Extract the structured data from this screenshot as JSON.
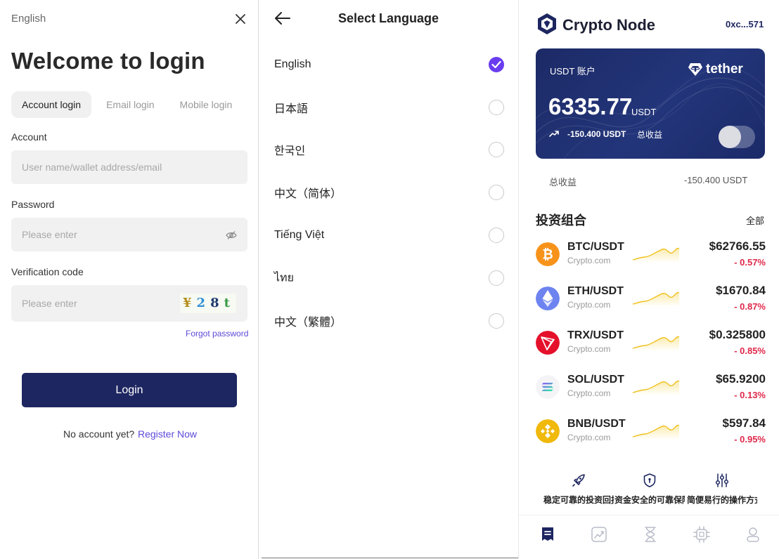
{
  "login": {
    "language": "English",
    "title": "Welcome to login",
    "tabs": [
      "Account login",
      "Email login",
      "Mobile login"
    ],
    "account_label": "Account",
    "account_placeholder": "User name/wallet address/email",
    "password_label": "Password",
    "password_placeholder": "Please enter",
    "code_label": "Verification code",
    "code_placeholder": "Please enter",
    "captcha_chars": [
      "¥",
      "2",
      "8",
      "t"
    ],
    "forgot": "Forgot password",
    "login_button": "Login",
    "no_account": "No account yet?",
    "register": "Register Now"
  },
  "language_picker": {
    "title": "Select Language",
    "selected": "English",
    "options": [
      "English",
      "日本語",
      "한국인",
      "中文（简体）",
      "Tiếng Việt",
      "ไทย",
      "中文（繁體）"
    ]
  },
  "crypto": {
    "app_name": "Crypto Node",
    "address": "0xc...571",
    "card": {
      "title": "USDT 账户",
      "brand": "tether",
      "amount": "6335.77",
      "unit": "USDT",
      "change": "-150.400 USDT",
      "change_label": "总收益",
      "toggle_on": false
    },
    "summary_label": "总收益",
    "summary_value": "-150.400 USDT",
    "portfolio_title": "投资组合",
    "portfolio_all": "全部",
    "coins": [
      {
        "pair": "BTC/USDT",
        "source": "Crypto.com",
        "price": "$62766.55",
        "change": "- 0.57%",
        "icon": "bitcoin-icon",
        "color": "#f7931a"
      },
      {
        "pair": "ETH/USDT",
        "source": "Crypto.com",
        "price": "$1670.84",
        "change": "- 0.87%",
        "icon": "ethereum-icon",
        "color": "#6d83ef"
      },
      {
        "pair": "TRX/USDT",
        "source": "Crypto.com",
        "price": "$0.325800",
        "change": "- 0.85%",
        "icon": "tron-icon",
        "color": "#e5112b"
      },
      {
        "pair": "SOL/USDT",
        "source": "Crypto.com",
        "price": "$65.9200",
        "change": "- 0.13%",
        "icon": "solana-icon",
        "color": "#9a4dff"
      },
      {
        "pair": "BNB/USDT",
        "source": "Crypto.com",
        "price": "$597.84",
        "change": "- 0.95%",
        "icon": "bnb-icon",
        "color": "#f0b90b"
      }
    ],
    "features": [
      {
        "text": "稳定可靠的投资回报",
        "icon": "rocket-icon"
      },
      {
        "text": "资金安全的可靠保障",
        "icon": "shield-icon"
      },
      {
        "text": "简便易行的操作方式",
        "icon": "sliders-icon"
      }
    ],
    "nav": [
      "home-icon",
      "chart-icon",
      "hourglass-icon",
      "chip-icon",
      "user-icon"
    ],
    "colors": {
      "primary": "#1d2660",
      "accent": "#6a3cf0",
      "negative": "#e0284a"
    }
  }
}
